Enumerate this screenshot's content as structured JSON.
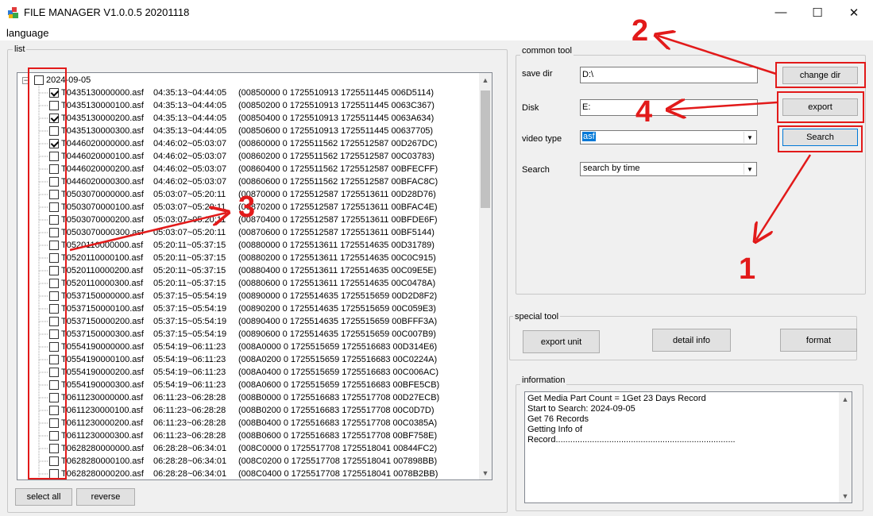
{
  "window": {
    "title": "FILE MANAGER V1.0.0.5 20201118",
    "app_icon": "colored-blocks-icon",
    "minimize_glyph": "—",
    "maximize_glyph": "☐",
    "close_glyph": "✕"
  },
  "menu": {
    "language": "language"
  },
  "list_group": {
    "label": "list",
    "root": {
      "label": "2024-09-05",
      "checked": false
    },
    "rows": [
      {
        "name": "T0435130000000.asf",
        "time": "04:35:13~04:44:05",
        "info": "(00850000 0 1725510913 1725511445 006D5114)",
        "checked": true
      },
      {
        "name": "T0435130000100.asf",
        "time": "04:35:13~04:44:05",
        "info": "(00850200 0 1725510913 1725511445 0063C367)",
        "checked": false
      },
      {
        "name": "T0435130000200.asf",
        "time": "04:35:13~04:44:05",
        "info": "(00850400 0 1725510913 1725511445 0063A634)",
        "checked": true
      },
      {
        "name": "T0435130000300.asf",
        "time": "04:35:13~04:44:05",
        "info": "(00850600 0 1725510913 1725511445 00637705)",
        "checked": false
      },
      {
        "name": "T0446020000000.asf",
        "time": "04:46:02~05:03:07",
        "info": "(00860000 0 1725511562 1725512587 00D267DC)",
        "checked": true
      },
      {
        "name": "T0446020000100.asf",
        "time": "04:46:02~05:03:07",
        "info": "(00860200 0 1725511562 1725512587 00C03783)",
        "checked": false
      },
      {
        "name": "T0446020000200.asf",
        "time": "04:46:02~05:03:07",
        "info": "(00860400 0 1725511562 1725512587 00BFECFF)",
        "checked": false
      },
      {
        "name": "T0446020000300.asf",
        "time": "04:46:02~05:03:07",
        "info": "(00860600 0 1725511562 1725512587 00BFAC8C)",
        "checked": false
      },
      {
        "name": "T0503070000000.asf",
        "time": "05:03:07~05:20:11",
        "info": "(00870000 0 1725512587 1725513611 00D28D76)",
        "checked": false
      },
      {
        "name": "T0503070000100.asf",
        "time": "05:03:07~05:20:11",
        "info": "(00870200 0 1725512587 1725513611 00BFAC4E)",
        "checked": false
      },
      {
        "name": "T0503070000200.asf",
        "time": "05:03:07~05:20:11",
        "info": "(00870400 0 1725512587 1725513611 00BFDE6F)",
        "checked": false
      },
      {
        "name": "T0503070000300.asf",
        "time": "05:03:07~05:20:11",
        "info": "(00870600 0 1725512587 1725513611 00BF5144)",
        "checked": false
      },
      {
        "name": "T0520110000000.asf",
        "time": "05:20:11~05:37:15",
        "info": "(00880000 0 1725513611 1725514635 00D31789)",
        "checked": false
      },
      {
        "name": "T0520110000100.asf",
        "time": "05:20:11~05:37:15",
        "info": "(00880200 0 1725513611 1725514635 00C0C915)",
        "checked": false
      },
      {
        "name": "T0520110000200.asf",
        "time": "05:20:11~05:37:15",
        "info": "(00880400 0 1725513611 1725514635 00C09E5E)",
        "checked": false
      },
      {
        "name": "T0520110000300.asf",
        "time": "05:20:11~05:37:15",
        "info": "(00880600 0 1725513611 1725514635 00C0478A)",
        "checked": false
      },
      {
        "name": "T0537150000000.asf",
        "time": "05:37:15~05:54:19",
        "info": "(00890000 0 1725514635 1725515659 00D2D8F2)",
        "checked": false
      },
      {
        "name": "T0537150000100.asf",
        "time": "05:37:15~05:54:19",
        "info": "(00890200 0 1725514635 1725515659 00C059E3)",
        "checked": false
      },
      {
        "name": "T0537150000200.asf",
        "time": "05:37:15~05:54:19",
        "info": "(00890400 0 1725514635 1725515659 00BFFF3A)",
        "checked": false
      },
      {
        "name": "T0537150000300.asf",
        "time": "05:37:15~05:54:19",
        "info": "(00890600 0 1725514635 1725515659 00C007B9)",
        "checked": false
      },
      {
        "name": "T0554190000000.asf",
        "time": "05:54:19~06:11:23",
        "info": "(008A0000 0 1725515659 1725516683 00D314E6)",
        "checked": false
      },
      {
        "name": "T0554190000100.asf",
        "time": "05:54:19~06:11:23",
        "info": "(008A0200 0 1725515659 1725516683 00C0224A)",
        "checked": false
      },
      {
        "name": "T0554190000200.asf",
        "time": "05:54:19~06:11:23",
        "info": "(008A0400 0 1725515659 1725516683 00C006AC)",
        "checked": false
      },
      {
        "name": "T0554190000300.asf",
        "time": "05:54:19~06:11:23",
        "info": "(008A0600 0 1725515659 1725516683 00BFE5CB)",
        "checked": false
      },
      {
        "name": "T0611230000000.asf",
        "time": "06:11:23~06:28:28",
        "info": "(008B0000 0 1725516683 1725517708 00D27ECB)",
        "checked": false
      },
      {
        "name": "T0611230000100.asf",
        "time": "06:11:23~06:28:28",
        "info": "(008B0200 0 1725516683 1725517708 00C0D7D)",
        "checked": false
      },
      {
        "name": "T0611230000200.asf",
        "time": "06:11:23~06:28:28",
        "info": "(008B0400 0 1725516683 1725517708 00C0385A)",
        "checked": false
      },
      {
        "name": "T0611230000300.asf",
        "time": "06:11:23~06:28:28",
        "info": "(008B0600 0 1725516683 1725517708 00BF758E)",
        "checked": false
      },
      {
        "name": "T0628280000000.asf",
        "time": "06:28:28~06:34:01",
        "info": "(008C0000 0 1725517708 1725518041 00844FC2)",
        "checked": false
      },
      {
        "name": "T0628280000100.asf",
        "time": "06:28:28~06:34:01",
        "info": "(008C0200 0 1725517708 1725518041 007898BB)",
        "checked": false
      },
      {
        "name": "T0628280000200.asf",
        "time": "06:28:28~06:34:01",
        "info": "(008C0400 0 1725517708 1725518041 0078B2BB)",
        "checked": false
      }
    ],
    "select_all": "select all",
    "reverse": "reverse"
  },
  "common_tool": {
    "label": "common tool",
    "save_dir_label": "save dir",
    "save_dir_value": "D:\\",
    "disk_label": "Disk",
    "disk_value": "E:",
    "video_type_label": "video type",
    "video_type_value": "asf",
    "search_label": "Search",
    "search_value": "search by time",
    "change_dir_button": "change dir",
    "export_button": "export",
    "search_button": "Search"
  },
  "special_tool": {
    "label": "special tool",
    "export_unit": "export unit",
    "detail_info": "detail info",
    "format": "format"
  },
  "information": {
    "label": "information",
    "text": "Get Media Part Count = 1Get 23 Days Record\nStart to Search: 2024-09-05\nGet 76 Records\nGetting Info of\nRecord.........................................................................."
  },
  "annotations": {
    "color": "#e21a1a",
    "labels": [
      "1",
      "2",
      "3",
      "4"
    ]
  }
}
